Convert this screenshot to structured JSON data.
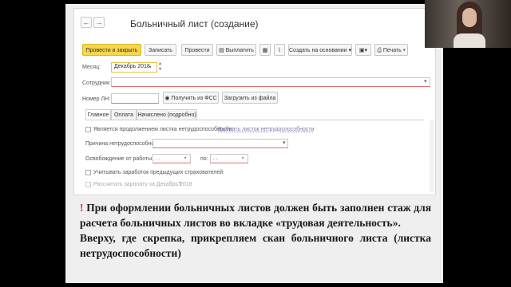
{
  "window": {
    "title": "Больничный лист (создание)",
    "nav_back": "←",
    "nav_forward": "→"
  },
  "toolbar": {
    "post_close": "Провести и закрыть",
    "save": "Записать",
    "post": "Провести",
    "pay": "Выплатить",
    "create_based": "Создать на основании",
    "print": "Печать"
  },
  "form": {
    "month_label": "Месяц:",
    "month_value": "Декабрь 2018",
    "employee_label": "Сотрудник:",
    "employee_value": "",
    "number_label": "Номер ЛН:",
    "number_value": "",
    "fss_button": "Получить из ФСС",
    "load_file_button": "Загрузить из файла"
  },
  "tabs": [
    "Главное",
    "Оплата",
    "Начислено (подробно)"
  ],
  "main_tab": {
    "continuation_label": "Является продолжением листка нетрудоспособности:",
    "select_link": "Выбрать листок нетрудоспособности",
    "reason_label": "Причина нетрудоспособности:",
    "release_label": "Освобождение от работы с:",
    "release_from": ". .",
    "to_label": "по:",
    "release_to": ". .",
    "previous_insurers_label": "Учитывать заработок предыдущих страхователей",
    "calc_salary_label": "Рассчитать зарплату за Декабрь 2018",
    "help_mark": "?"
  },
  "note": {
    "exclamation": "!",
    "paragraph1": "При оформлении больничных листов должен быть заполнен стаж для расчета больничных листов во вкладке «трудовая деятельность».",
    "paragraph2": "Вверху, где скрепка, прикрепляем скан больничного листа (листка нетрудоспособности)"
  }
}
